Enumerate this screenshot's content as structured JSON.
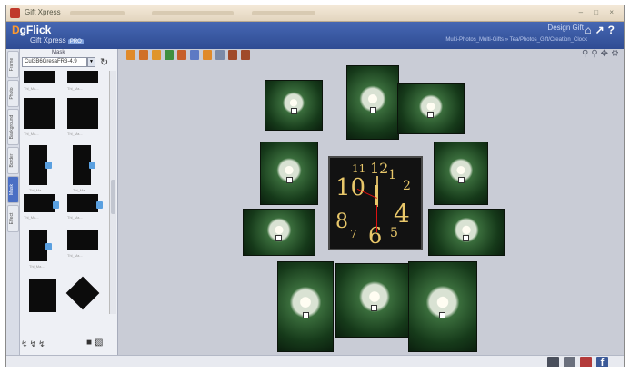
{
  "window": {
    "title": "Gift Xpress"
  },
  "header": {
    "logo_d": "D",
    "logo_rest": "gFlick",
    "sub": "Gift Xpress",
    "sub_tag": "PRO",
    "design_gift": "Design Gift",
    "breadcrumb": "Multi-Photos_Multi-Gifts » Tea/Photos_Gift/Creation_Clock"
  },
  "left_panel": {
    "tabs": [
      "Frame",
      "Photo",
      "Background",
      "Border",
      "Mask",
      "Effect"
    ],
    "active_tab": "Mask",
    "section_label": "Mask",
    "category_value": "Cul3B6GresaFR3-4.9",
    "thumb_caption": "Thl_Ma..."
  },
  "clock": {
    "numerals": [
      "10",
      "12",
      "1",
      "8",
      "4",
      "6",
      "5",
      "7",
      "2",
      "11"
    ]
  },
  "colors": {
    "header": "#2f4c93",
    "accent": "#ff9a2e",
    "canvas": "#c9ccd6"
  },
  "icons": [
    "home-icon",
    "tools-icon",
    "help-icon",
    "save-icon",
    "print-icon",
    "export-icon",
    "facebook-icon"
  ]
}
